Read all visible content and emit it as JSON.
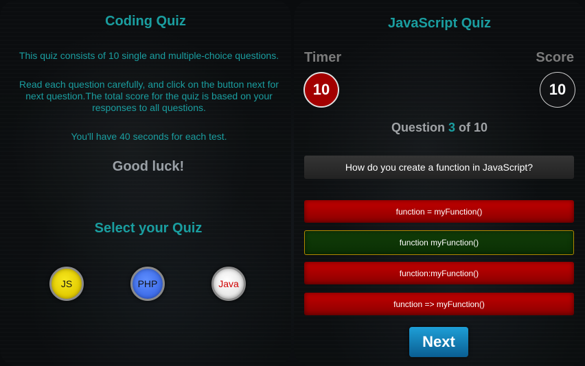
{
  "colors": {
    "accent": "#1a9ea0",
    "muted": "#7b7b7b",
    "option_wrong": "#a30000",
    "option_correct": "#0b3004",
    "next": "#1e8ac4"
  },
  "left": {
    "title": "Coding Quiz",
    "intro": "This quiz consists of 10 single and multiple-choice questions.",
    "instructions": "Read each question carefully, and click on the button next for next question.The total score for the quiz is based on your responses to all questions.",
    "time_note": "You'll have 40 seconds for each test.",
    "good_luck": "Good luck!",
    "select_label": "Select your Quiz",
    "quizzes": [
      {
        "label": "JS"
      },
      {
        "label": "PHP"
      },
      {
        "label": "Java"
      }
    ]
  },
  "right": {
    "title": "JavaScript Quiz",
    "timer_label": "Timer",
    "timer_value": "10",
    "score_label": "Score",
    "score_value": "10",
    "progress": {
      "prefix": "Question",
      "current": "3",
      "middle": "of",
      "total": "10"
    },
    "question": "How do you create a function in JavaScript?",
    "options": [
      {
        "label": "function = myFunction()",
        "state": "wrong"
      },
      {
        "label": "function myFunction()",
        "state": "correct"
      },
      {
        "label": "function:myFunction()",
        "state": "wrong"
      },
      {
        "label": "function => myFunction()",
        "state": "wrong"
      }
    ],
    "next_label": "Next"
  }
}
